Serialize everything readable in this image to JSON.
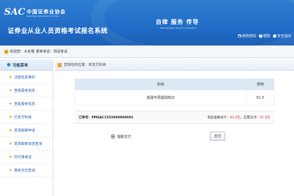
{
  "header": {
    "logo_mark": "SAC",
    "org_cn": "中国证券业协会",
    "org_en": "Securities Association of China",
    "system_title": "证券业从业人员资格考试报名系统",
    "slogan_cn": "自律  服务  传导",
    "slogan_en": "Self-regulation  Service  Conduction",
    "links": [
      {
        "label": "修改密码",
        "icon": "lock-icon"
      },
      {
        "label": "帮助",
        "icon": "help-icon"
      },
      {
        "label": "安全退出",
        "icon": "exit-icon"
      }
    ]
  },
  "infobar": {
    "welcome": "欢迎您：大名哦",
    "exam": "报考考试：测试考试"
  },
  "sidebar": {
    "title": "功能菜单",
    "items": [
      {
        "label": "注册信息维护"
      },
      {
        "label": "查看报考状态"
      },
      {
        "label": "查看报考信息"
      },
      {
        "label": "已支付科目"
      },
      {
        "label": "发票邮寄申请"
      },
      {
        "label": "发票邮寄状态查询"
      },
      {
        "label": "打印准考证"
      },
      {
        "label": "报考日志查询"
      }
    ]
  },
  "breadcrumb": {
    "text": "您现在的位置：未支付科目"
  },
  "table": {
    "headers": [
      "科目",
      "费用"
    ],
    "rows": [
      {
        "subject": "金融市场基础知识",
        "fee": "61.0"
      }
    ]
  },
  "order": {
    "order_no": "订单号：PMSAC1552000000001",
    "total_label": "商品金额总计：",
    "total_value": "61.0元",
    "sep": "，",
    "paid_label": "应需支付：",
    "paid_value": "61.0元"
  },
  "payment": {
    "method_label": "银联支付",
    "pay_button": "支付"
  }
}
